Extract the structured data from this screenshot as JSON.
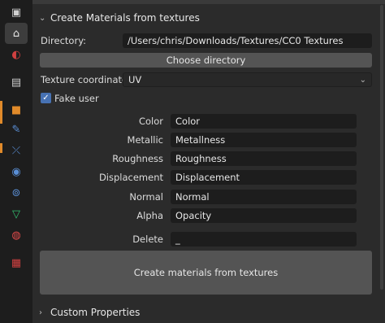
{
  "tabs": [
    {
      "name": "render-properties-icon",
      "color": "#cfcfcf",
      "glyph": "▣"
    },
    {
      "name": "output-properties-icon",
      "color": "#cfcfcf",
      "glyph": "⌂"
    },
    {
      "name": "view-layer-properties-icon",
      "color": "#d04040",
      "glyph": "◐"
    },
    {
      "name": "scene-properties-icon",
      "color": "#cfcfcf",
      "glyph": "▤"
    },
    {
      "name": "object-properties-icon",
      "color": "#e08a2a",
      "glyph": "■"
    },
    {
      "name": "modifier-properties-icon",
      "color": "#5a8fd6",
      "glyph": "🔧"
    },
    {
      "name": "particles-properties-icon",
      "color": "#5a8fd6",
      "glyph": "⤫"
    },
    {
      "name": "physics-properties-icon",
      "color": "#5a8fd6",
      "glyph": "◉"
    },
    {
      "name": "constraints-properties-icon",
      "color": "#5a8fd6",
      "glyph": "⊚"
    },
    {
      "name": "data-properties-icon",
      "color": "#33c070",
      "glyph": "▽"
    },
    {
      "name": "material-properties-icon",
      "color": "#e04a4a",
      "glyph": "◍"
    },
    {
      "name": "texture-properties-icon",
      "color": "#d04040",
      "glyph": "▦"
    }
  ],
  "section": {
    "title": "Create Materials from textures"
  },
  "directory": {
    "label": "Directory:",
    "value": "/Users/chris/Downloads/Textures/CC0 Textures"
  },
  "choose_directory_label": "Choose directory",
  "texture_coordinate": {
    "label": "Texture coordinate:",
    "value": "UV"
  },
  "fake_user": {
    "label": "Fake user",
    "checked": true
  },
  "maps": [
    {
      "label": "Color",
      "value": "Color"
    },
    {
      "label": "Metallic",
      "value": "Metallness"
    },
    {
      "label": "Roughness",
      "value": "Roughness"
    },
    {
      "label": "Displacement",
      "value": "Displacement"
    },
    {
      "label": "Normal",
      "value": "Normal"
    },
    {
      "label": "Alpha",
      "value": "Opacity"
    }
  ],
  "delete": {
    "label": "Delete",
    "value": "_"
  },
  "create_button_label": "Create materials from textures",
  "custom_properties": {
    "title": "Custom Properties"
  },
  "colors": {
    "accent": "#4772b3",
    "panel": "#2b2b2b",
    "field": "#1d1d1d",
    "button": "#545454"
  }
}
